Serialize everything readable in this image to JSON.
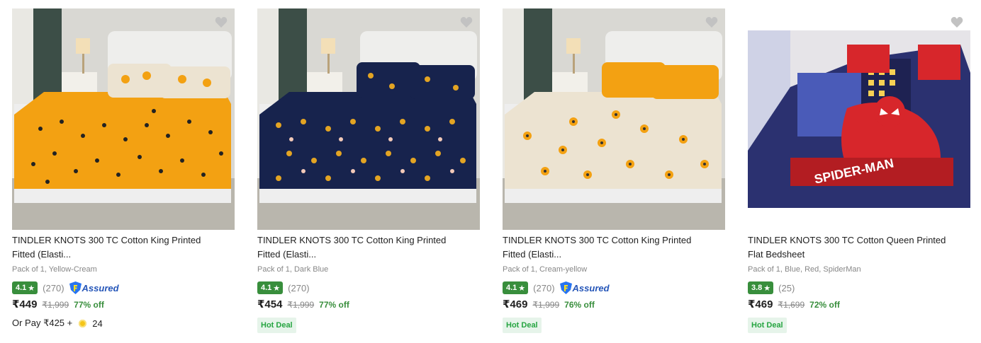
{
  "products": [
    {
      "title_line1": "TINDLER KNOTS 300 TC Cotton King Printed",
      "title_line2": "Fitted (Elasti...",
      "variant": "Pack of 1, Yellow-Cream",
      "rating": "4.1",
      "rating_count": "(270)",
      "assured": true,
      "assured_label": "Assured",
      "price": "₹449",
      "mrp": "₹1,999",
      "discount": "77% off",
      "or_pay": "Or Pay ₹425 +",
      "coins": "24",
      "image": {
        "sheet_color": "#f3a112",
        "pattern": "sunflower",
        "pillow_color": "#ece3d1"
      }
    },
    {
      "title_line1": "TINDLER KNOTS 300 TC Cotton King Printed",
      "title_line2": "Fitted (Elasti...",
      "variant": "Pack of 1, Dark Blue",
      "rating": "4.1",
      "rating_count": "(270)",
      "assured": false,
      "price": "₹454",
      "mrp": "₹1,999",
      "discount": "77% off",
      "deal_label": "Hot Deal",
      "image": {
        "sheet_color": "#17234d",
        "pattern": "tulip",
        "pillow_color": "#17234d"
      }
    },
    {
      "title_line1": "TINDLER KNOTS 300 TC Cotton King Printed",
      "title_line2": "Fitted (Elasti...",
      "variant": "Pack of 1, Cream-yellow",
      "rating": "4.1",
      "rating_count": "(270)",
      "assured": true,
      "assured_label": "Assured",
      "price": "₹469",
      "mrp": "₹1,999",
      "discount": "76% off",
      "deal_label": "Hot Deal",
      "image": {
        "sheet_color": "#ece3d1",
        "pattern": "sunflower",
        "pillow_color": "#f3a112"
      }
    },
    {
      "title_line1": "TINDLER KNOTS 300 TC Cotton Queen Printed",
      "title_line2": "Flat Bedsheet",
      "variant": "Pack of 1, Blue, Red, SpiderMan",
      "rating": "3.8",
      "rating_count": "(25)",
      "assured": false,
      "price": "₹469",
      "mrp": "₹1,699",
      "discount": "72% off",
      "deal_label": "Hot Deal",
      "image": {
        "sheet_color": "#2b3170",
        "pattern": "spiderman",
        "logo_text": "SPIDER-MAN"
      }
    }
  ]
}
